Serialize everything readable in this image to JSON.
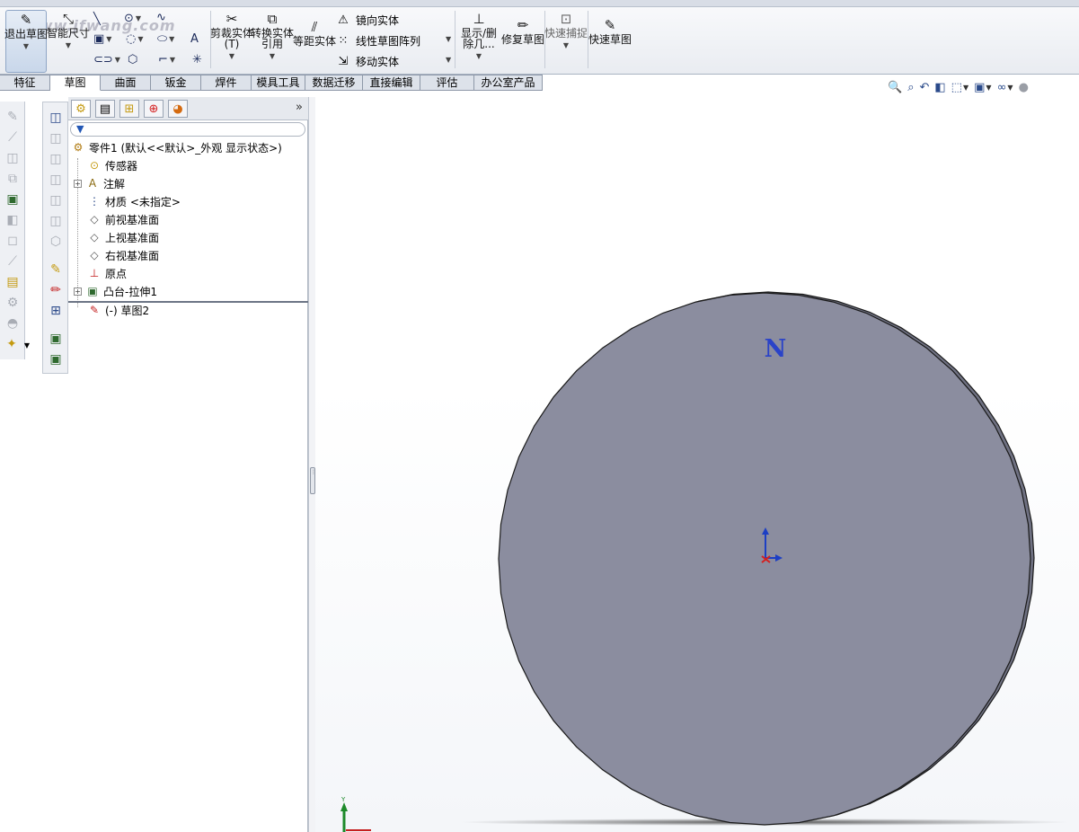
{
  "ribbon": {
    "exit_sketch": "退出草图",
    "smart_dim": "智能尺寸",
    "trim": "剪裁实体(T)",
    "convert": "转换实体引用",
    "offset": "等距实体",
    "mirror": "镜向实体",
    "linear_pattern": "线性草图阵列",
    "move": "移动实体",
    "display_delete": "显示/删除几...",
    "repair": "修复草图",
    "quick_snap": "快速捕捉",
    "quick_sketch": "快速草图",
    "watermark": "www.jfwang.com"
  },
  "tabs": [
    "特征",
    "草图",
    "曲面",
    "钣金",
    "焊件",
    "模具工具",
    "数据迁移",
    "直接编辑",
    "评估",
    "办公室产品"
  ],
  "active_tab": "草图",
  "tree": {
    "root": "零件1  (默认<<默认>_外观 显示状态>)",
    "items": [
      {
        "label": "传感器",
        "icon": "sensor-icon",
        "expandable": false
      },
      {
        "label": "注解",
        "icon": "annotation-icon",
        "expandable": true
      },
      {
        "label": "材质 <未指定>",
        "icon": "material-icon",
        "expandable": false
      },
      {
        "label": "前视基准面",
        "icon": "plane-icon",
        "expandable": false
      },
      {
        "label": "上视基准面",
        "icon": "plane-icon",
        "expandable": false
      },
      {
        "label": "右视基准面",
        "icon": "plane-icon",
        "expandable": false
      },
      {
        "label": "原点",
        "icon": "origin-icon",
        "expandable": false
      },
      {
        "label": "凸台-拉伸1",
        "icon": "extrude-icon",
        "expandable": true
      }
    ],
    "sketch": "(-) 草图2"
  },
  "graphics": {
    "view_label": "N",
    "axis_y": "Y",
    "disc_color": "#8b8d9f",
    "edge_color": "#1a1a1a"
  }
}
